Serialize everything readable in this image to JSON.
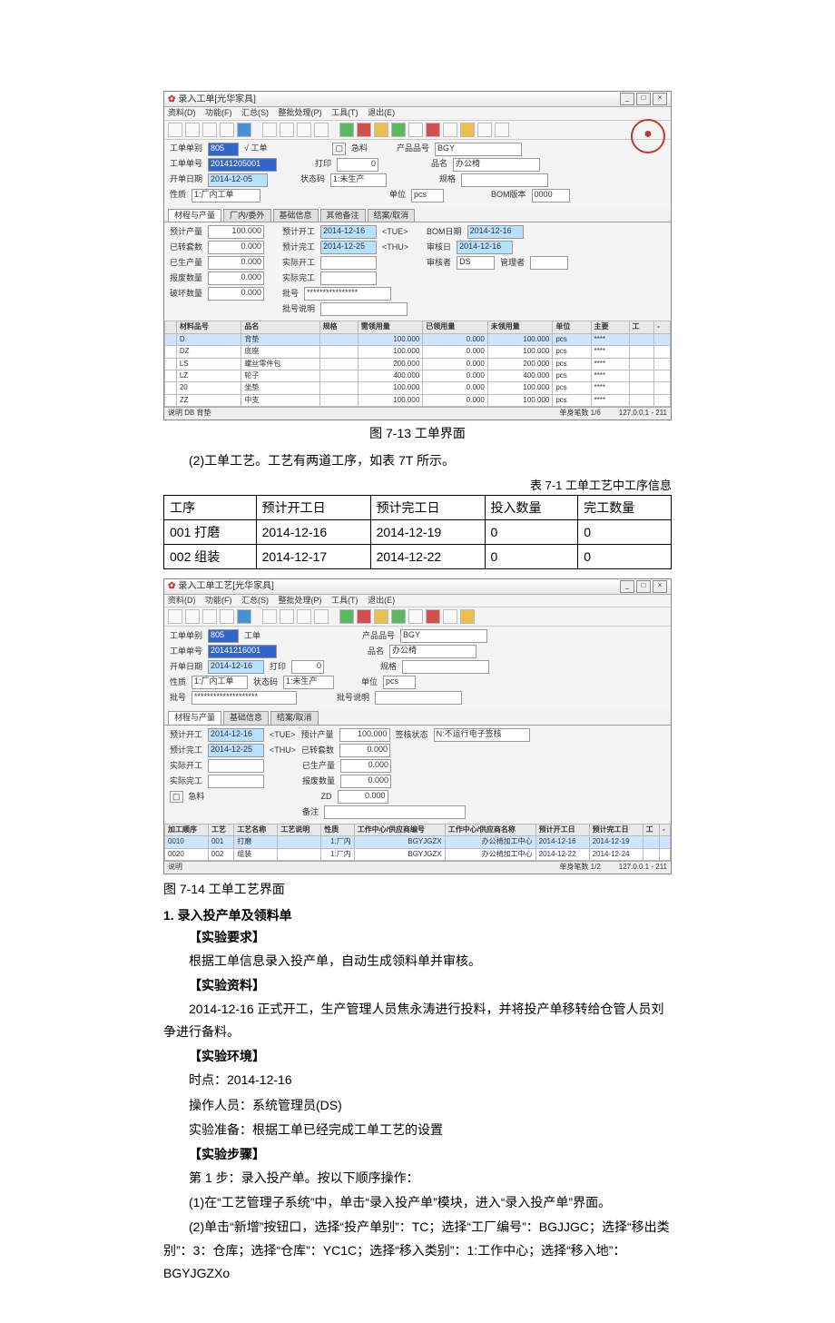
{
  "fig713": {
    "title": "录入工单[光华家具]",
    "menus": [
      "资料(D)",
      "功能(F)",
      "汇总(S)",
      "整批处理(P)",
      "工具(T)",
      "退出(E)"
    ],
    "header": {
      "gdlb_label": "工单单别",
      "gdlb_val": "805",
      "gd_tag": "√ 工单",
      "jl_label": "急料",
      "pbh_label": "产品品号",
      "pbh_val": "BGY",
      "gdh_label": "工单单号",
      "gdh_val": "20141205001",
      "dy_label": "打印",
      "dy_val": "0",
      "pm_label": "品名",
      "pm_val": "办公椅",
      "kdrq_label": "开单日期",
      "kdrq_val": "2014-12-05",
      "ztm_label": "状态码",
      "ztm_val": "1:未生产",
      "gg_label": "规格",
      "xz_label": "性质",
      "xz_val": "1:厂内工单",
      "dw_label": "单位",
      "dw_val": "pcs",
      "bom_label": "BOM版本",
      "bom_val": "0000"
    },
    "tabs": [
      "材程与产量",
      "厂内/委外",
      "基础信息",
      "其他备注",
      "结案/取消"
    ],
    "left": {
      "yjcl_l": "预计产量",
      "yjcl_v": "100.000",
      "yjts_l": "已转套数",
      "yjts_v": "0.000",
      "yscl_l": "已生产量",
      "yscl_v": "0.000",
      "bfsl_l": "报废数量",
      "bfsl_v": "0.000",
      "phsl_l": "破坏数量",
      "phsl_v": "0.000"
    },
    "mid": {
      "yjkg_l": "预计开工",
      "yjkg_v": "2014-12-16",
      "tue": "<TUE>",
      "yjwg_l": "预计完工",
      "yjwg_v": "2014-12-25",
      "thu": "<THU>",
      "sjkg_l": "实际开工",
      "sjwg_l": "实际完工",
      "ph_l": "批号",
      "ph_v": "****************",
      "phsm_l": "批号说明"
    },
    "right": {
      "bomrq_l": "BOM日期",
      "bomrq_v": "2014-12-16",
      "shr_l": "审核日",
      "shr_v": "2014-12-16",
      "shz_l": "审核者",
      "shz_v": "DS",
      "glz_l": "管理者"
    },
    "grid_headers": [
      "",
      "材料品号",
      "品名",
      "规格",
      "需领用量",
      "已领用量",
      "未领用量",
      "单位",
      "主要",
      "工",
      "-"
    ],
    "grid_rows": [
      [
        "",
        "D",
        "背垫",
        "",
        "100.000",
        "0.000",
        "100.000",
        "pcs",
        "****",
        "",
        ""
      ],
      [
        "",
        "DZ",
        "底座",
        "",
        "100.000",
        "0.000",
        "100.000",
        "pcs",
        "****",
        "",
        ""
      ],
      [
        "",
        "LS",
        "螺丝零件包",
        "",
        "200.000",
        "0.000",
        "200.000",
        "pcs",
        "****",
        "",
        ""
      ],
      [
        "",
        "LZ",
        "轮子",
        "",
        "400.000",
        "0.000",
        "400.000",
        "pcs",
        "****",
        "",
        ""
      ],
      [
        "",
        "20",
        "坐垫",
        "",
        "100.000",
        "0.000",
        "100.000",
        "pcs",
        "****",
        "",
        ""
      ],
      [
        "",
        "ZZ",
        "中支",
        "",
        "100.000",
        "0.000",
        "100.000",
        "pcs",
        "****",
        "",
        ""
      ]
    ],
    "status_left": "说明  DB 背垫",
    "status_mid": "单身笔数  1/6",
    "status_right": "127.0.0.1 - 211",
    "caption": "图 7-13 工单界面"
  },
  "para2": "(2)工单工艺。工艺有两道工序，如表 7T 所示。",
  "table_cap": "表 7-1 工单工艺中工序信息",
  "proc_table": {
    "headers": [
      "工序",
      "预计开工日",
      "预计完工日",
      "投入数量",
      "完工数量"
    ],
    "rows": [
      [
        "001 打磨",
        "2014-12-16",
        "2014-12-19",
        "0",
        "0"
      ],
      [
        "002 组装",
        "2014-12-17",
        "2014-12-22",
        "0",
        "0"
      ]
    ]
  },
  "fig714": {
    "title": "录入工单工艺[光华家具]",
    "menus": [
      "资料(D)",
      "功能(F)",
      "汇总(S)",
      "整批处理(P)",
      "工具(T)",
      "退出(E)"
    ],
    "header": {
      "gdlb_l": "工单单别",
      "gdlb_v": "805",
      "gd_tag": "工单",
      "pbh_l": "产品品号",
      "pbh_v": "BGY",
      "gdh_l": "工单单号",
      "gdh_v": "20141216001",
      "pm_l": "品名",
      "pm_v": "办公椅",
      "kdrq_l": "开单日期",
      "kdrq_v": "2014-12-16",
      "dy_l": "打印",
      "dy_v": "0",
      "gg_l": "规格",
      "xz_l": "性质",
      "xz_v": "1:厂内工单",
      "ztm_l": "状态码",
      "ztm_v": "1:未生产",
      "dw_l": "单位",
      "dw_v": "pcs",
      "ph_l": "批号",
      "ph_v": "********************",
      "phsm_l": "批号说明"
    },
    "tabs": [
      "材程与产量",
      "基础信息",
      "结案/取消"
    ],
    "sec": {
      "yjkg_l": "预计开工",
      "yjkg_v": "2014-12-16",
      "tue": "<TUE>",
      "yjcl_l": "预计产量",
      "yjcl_v": "100.000",
      "qhzt_l": "签核状态",
      "qhzt_v": "N:不运行电子签核",
      "yjwg_l": "预计完工",
      "yjwg_v": "2014-12-25",
      "thu": "<THU>",
      "yzts_l": "已转套数",
      "yzts_v": "0.000",
      "sjkg_l": "实际开工",
      "yscl_l": "已生产量",
      "yscl_v": "0.000",
      "sjwg_l": "实际完工",
      "bfsl_l": "报废数量",
      "bfsl_v": "0.000",
      "jl_l": "急料",
      "ZD": "ZD",
      "bz_l": "备注"
    },
    "grid_headers": [
      "加工顺序",
      "工艺",
      "工艺名称",
      "工艺说明",
      "性质",
      "工作中心/供应商编号",
      "工作中心/供应商名称",
      "预计开工日",
      "预计完工日",
      "工",
      "-"
    ],
    "grid_rows": [
      [
        "0010",
        "001",
        "打磨",
        "",
        "1:厂内",
        "BGYJGZX",
        "办公椅加工中心",
        "2014-12-16",
        "2014-12-19",
        "",
        ""
      ],
      [
        "0020",
        "002",
        "组装",
        "",
        "1:厂内",
        "BGYJGZX",
        "办公椅加工中心",
        "2014-12-22",
        "2014-12-24",
        "",
        ""
      ]
    ],
    "status_left": "说明",
    "status_mid": "单身笔数  1/2",
    "status_right": "127.0.0.1 - 211",
    "caption": "图 7-14 工单工艺界面"
  },
  "section1": "1. 录入投产单及领料单",
  "req_h": "【实验要求】",
  "req_t": "根据工单信息录入投产单，自动生成领料单并审核。",
  "mat_h": "【实验资料】",
  "mat_t": "2014-12-16 正式开工，生产管理人员焦永涛进行投料，并将投产单移转给仓管人员刘争进行备料。",
  "env_h": "【实验环境】",
  "env_1": "时点：2014-12-16",
  "env_2": "操作人员：系统管理员(DS)",
  "env_3": "实验准备：根据工单已经完成工单工艺的设置",
  "step_h": "【实验步骤】",
  "step_1": "第 1 步：录入投产单。按以下顺序操作：",
  "step_1_1": "(1)在“工艺管理子系统”中，单击“录入投产单”模块，进入“录入投产单”界面。",
  "step_1_2": "(2)单击“新增”按钮口，选择“投产单别”：TC；选择“工厂编号”：BGJJGC；选择“移出类别”：3：仓库；选择“仓库”：YC1C；选择“移入类别”：1:工作中心；选择“移入地”：BGYJGZXo"
}
